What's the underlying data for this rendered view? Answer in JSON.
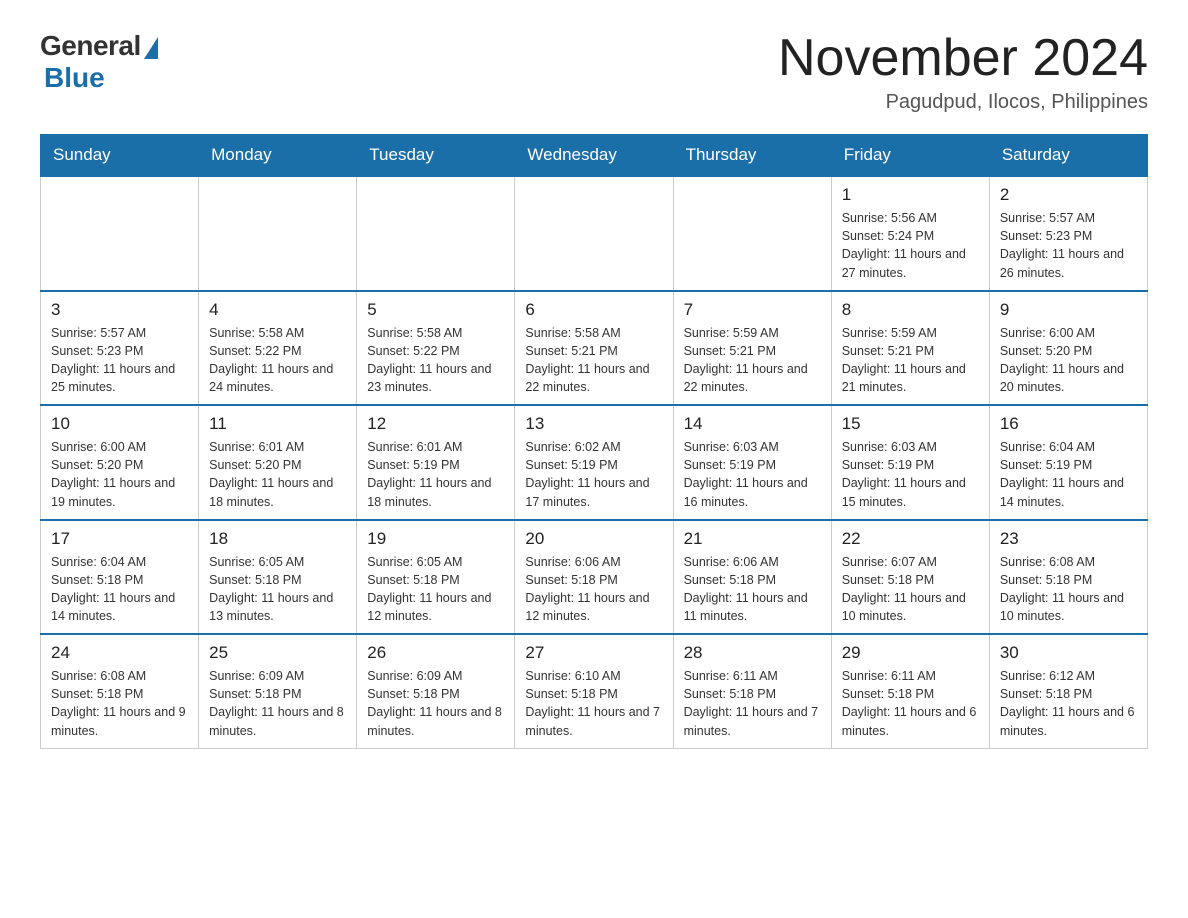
{
  "header": {
    "logo": {
      "general": "General",
      "blue": "Blue"
    },
    "title": "November 2024",
    "location": "Pagudpud, Ilocos, Philippines"
  },
  "days_of_week": [
    "Sunday",
    "Monday",
    "Tuesday",
    "Wednesday",
    "Thursday",
    "Friday",
    "Saturday"
  ],
  "weeks": [
    [
      null,
      null,
      null,
      null,
      null,
      {
        "day": "1",
        "info": "Sunrise: 5:56 AM\nSunset: 5:24 PM\nDaylight: 11 hours and 27 minutes."
      },
      {
        "day": "2",
        "info": "Sunrise: 5:57 AM\nSunset: 5:23 PM\nDaylight: 11 hours and 26 minutes."
      }
    ],
    [
      {
        "day": "3",
        "info": "Sunrise: 5:57 AM\nSunset: 5:23 PM\nDaylight: 11 hours and 25 minutes."
      },
      {
        "day": "4",
        "info": "Sunrise: 5:58 AM\nSunset: 5:22 PM\nDaylight: 11 hours and 24 minutes."
      },
      {
        "day": "5",
        "info": "Sunrise: 5:58 AM\nSunset: 5:22 PM\nDaylight: 11 hours and 23 minutes."
      },
      {
        "day": "6",
        "info": "Sunrise: 5:58 AM\nSunset: 5:21 PM\nDaylight: 11 hours and 22 minutes."
      },
      {
        "day": "7",
        "info": "Sunrise: 5:59 AM\nSunset: 5:21 PM\nDaylight: 11 hours and 22 minutes."
      },
      {
        "day": "8",
        "info": "Sunrise: 5:59 AM\nSunset: 5:21 PM\nDaylight: 11 hours and 21 minutes."
      },
      {
        "day": "9",
        "info": "Sunrise: 6:00 AM\nSunset: 5:20 PM\nDaylight: 11 hours and 20 minutes."
      }
    ],
    [
      {
        "day": "10",
        "info": "Sunrise: 6:00 AM\nSunset: 5:20 PM\nDaylight: 11 hours and 19 minutes."
      },
      {
        "day": "11",
        "info": "Sunrise: 6:01 AM\nSunset: 5:20 PM\nDaylight: 11 hours and 18 minutes."
      },
      {
        "day": "12",
        "info": "Sunrise: 6:01 AM\nSunset: 5:19 PM\nDaylight: 11 hours and 18 minutes."
      },
      {
        "day": "13",
        "info": "Sunrise: 6:02 AM\nSunset: 5:19 PM\nDaylight: 11 hours and 17 minutes."
      },
      {
        "day": "14",
        "info": "Sunrise: 6:03 AM\nSunset: 5:19 PM\nDaylight: 11 hours and 16 minutes."
      },
      {
        "day": "15",
        "info": "Sunrise: 6:03 AM\nSunset: 5:19 PM\nDaylight: 11 hours and 15 minutes."
      },
      {
        "day": "16",
        "info": "Sunrise: 6:04 AM\nSunset: 5:19 PM\nDaylight: 11 hours and 14 minutes."
      }
    ],
    [
      {
        "day": "17",
        "info": "Sunrise: 6:04 AM\nSunset: 5:18 PM\nDaylight: 11 hours and 14 minutes."
      },
      {
        "day": "18",
        "info": "Sunrise: 6:05 AM\nSunset: 5:18 PM\nDaylight: 11 hours and 13 minutes."
      },
      {
        "day": "19",
        "info": "Sunrise: 6:05 AM\nSunset: 5:18 PM\nDaylight: 11 hours and 12 minutes."
      },
      {
        "day": "20",
        "info": "Sunrise: 6:06 AM\nSunset: 5:18 PM\nDaylight: 11 hours and 12 minutes."
      },
      {
        "day": "21",
        "info": "Sunrise: 6:06 AM\nSunset: 5:18 PM\nDaylight: 11 hours and 11 minutes."
      },
      {
        "day": "22",
        "info": "Sunrise: 6:07 AM\nSunset: 5:18 PM\nDaylight: 11 hours and 10 minutes."
      },
      {
        "day": "23",
        "info": "Sunrise: 6:08 AM\nSunset: 5:18 PM\nDaylight: 11 hours and 10 minutes."
      }
    ],
    [
      {
        "day": "24",
        "info": "Sunrise: 6:08 AM\nSunset: 5:18 PM\nDaylight: 11 hours and 9 minutes."
      },
      {
        "day": "25",
        "info": "Sunrise: 6:09 AM\nSunset: 5:18 PM\nDaylight: 11 hours and 8 minutes."
      },
      {
        "day": "26",
        "info": "Sunrise: 6:09 AM\nSunset: 5:18 PM\nDaylight: 11 hours and 8 minutes."
      },
      {
        "day": "27",
        "info": "Sunrise: 6:10 AM\nSunset: 5:18 PM\nDaylight: 11 hours and 7 minutes."
      },
      {
        "day": "28",
        "info": "Sunrise: 6:11 AM\nSunset: 5:18 PM\nDaylight: 11 hours and 7 minutes."
      },
      {
        "day": "29",
        "info": "Sunrise: 6:11 AM\nSunset: 5:18 PM\nDaylight: 11 hours and 6 minutes."
      },
      {
        "day": "30",
        "info": "Sunrise: 6:12 AM\nSunset: 5:18 PM\nDaylight: 11 hours and 6 minutes."
      }
    ]
  ]
}
